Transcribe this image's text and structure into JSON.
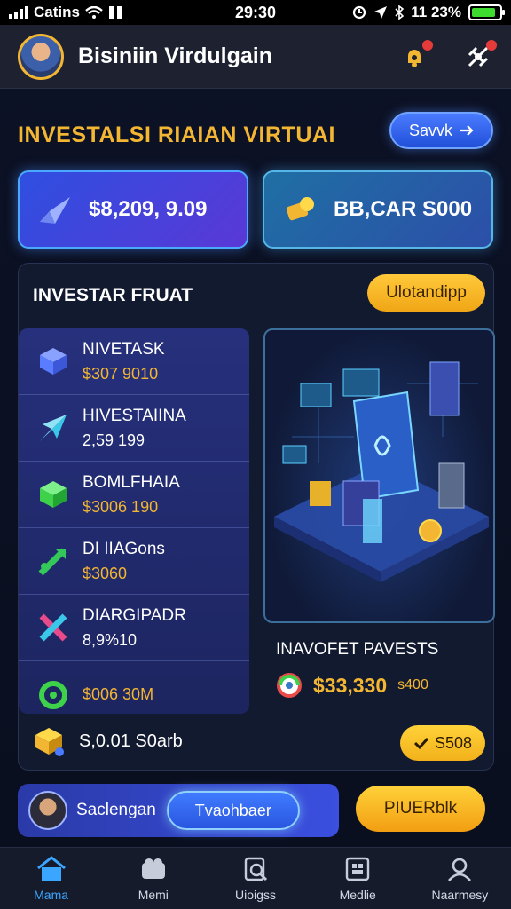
{
  "status_bar": {
    "carrier": "Catins",
    "time": "29:30",
    "battery_percent": "11 23%",
    "battery_level": 0.85
  },
  "header": {
    "title": "Bisiniin Virdulgain"
  },
  "section": {
    "title": "INVESTALSI RIAIAN VIRTUAI",
    "save_label": "Savvk"
  },
  "balances": [
    {
      "value": "$8,209, 9.09",
      "icon": "paper-plane-icon"
    },
    {
      "value": "BB,CAR S000",
      "icon": "gold-coin-icon"
    }
  ],
  "panel": {
    "title": "INVESTAR FRUAT",
    "update_label": "Ulotandipp",
    "items": [
      {
        "name": "NIVETASK",
        "value": "$307 9010",
        "value_color": "#f2b632",
        "icon": "cube-icon",
        "icon_color": "#5a7dff"
      },
      {
        "name": "HIVESTAIINA",
        "value": "2,59 199",
        "value_color": "#ffffff",
        "icon": "arrow-icon",
        "icon_color": "#3bc7e8"
      },
      {
        "name": "BOMLFHAIA",
        "value": "$3006 190",
        "value_color": "#f2b632",
        "icon": "green-cube-icon",
        "icon_color": "#3ed24a"
      },
      {
        "name": "DI IIAGons",
        "value": "$3060",
        "value_color": "#f2b632",
        "icon": "green-arrow-icon",
        "icon_color": "#34c759"
      },
      {
        "name": "DIARGIPADR",
        "value": "8,9%10",
        "value_color": "#ffffff",
        "icon": "cross-arrows-icon",
        "icon_color": "#e94a8a"
      },
      {
        "name": "",
        "value": "$006 30M",
        "value_color": "#f2b632",
        "icon": "green-ring-icon",
        "icon_color": "#3ed24a"
      }
    ],
    "payment": {
      "title": "INAVOFET PAVESTS",
      "amount": "$33,330",
      "suffix": "s400"
    },
    "footer": {
      "label": "S,0.01 S0arb",
      "coin_label": "S508"
    }
  },
  "profile_bar": {
    "name": "Saclengan",
    "action_label": "Tvaohbaer",
    "secondary_label": "PIUERblk"
  },
  "nav": [
    {
      "label": "Mama",
      "icon": "home-icon",
      "active": true
    },
    {
      "label": "Memi",
      "icon": "chat-icon",
      "active": false
    },
    {
      "label": "Uioigss",
      "icon": "search-icon",
      "active": false
    },
    {
      "label": "Medlie",
      "icon": "grid-icon",
      "active": false
    },
    {
      "label": "Naarmesy",
      "icon": "profile-icon",
      "active": false
    }
  ]
}
